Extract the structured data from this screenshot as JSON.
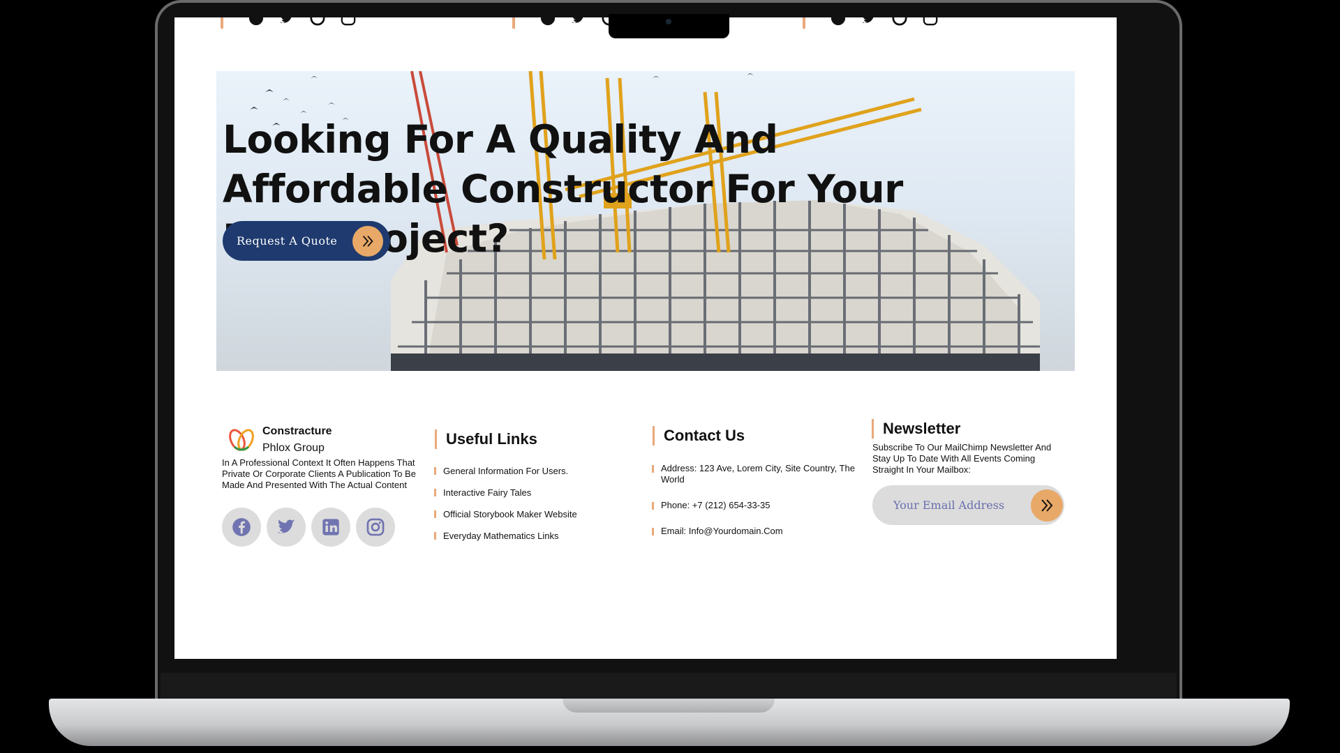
{
  "hero": {
    "title": "Looking For A Quality And Affordable Constructor For Your Next Project?",
    "cta_label": "Request A Quote"
  },
  "top_social_icons": [
    "facebook-icon",
    "twitter-icon",
    "pinterest-icon",
    "instagram-icon"
  ],
  "brand": {
    "name": "Constracture",
    "sub": "Phlox Group",
    "about": "In A Professional Context It Often Happens That Private Or Corporate Clients A Publication To Be Made And Presented With The Actual Content"
  },
  "social_icons": [
    "facebook-icon",
    "twitter-icon",
    "linkedin-icon",
    "instagram-icon"
  ],
  "useful_links": {
    "title": "Useful Links",
    "items": [
      "General Information For Users.",
      "Interactive Fairy Tales",
      "Official Storybook Maker Website",
      "Everyday Mathematics Links"
    ]
  },
  "contact": {
    "title": "Contact Us",
    "address": "Address: 123 Ave, Lorem City, Site Country, The World",
    "phone": "Phone: +7 (212) 654-33-35",
    "email": "Email: Info@Yourdomain.Com"
  },
  "newsletter": {
    "title": "Newsletter",
    "text": "Subscribe To Our MailChimp Newsletter And Stay Up To Date With All Events Coming Straight In Your Mailbox:",
    "placeholder": "Your Email Address"
  },
  "colors": {
    "accent": "#e9a87a",
    "navy": "#1e3a6e",
    "social_icon": "#7074b0"
  }
}
